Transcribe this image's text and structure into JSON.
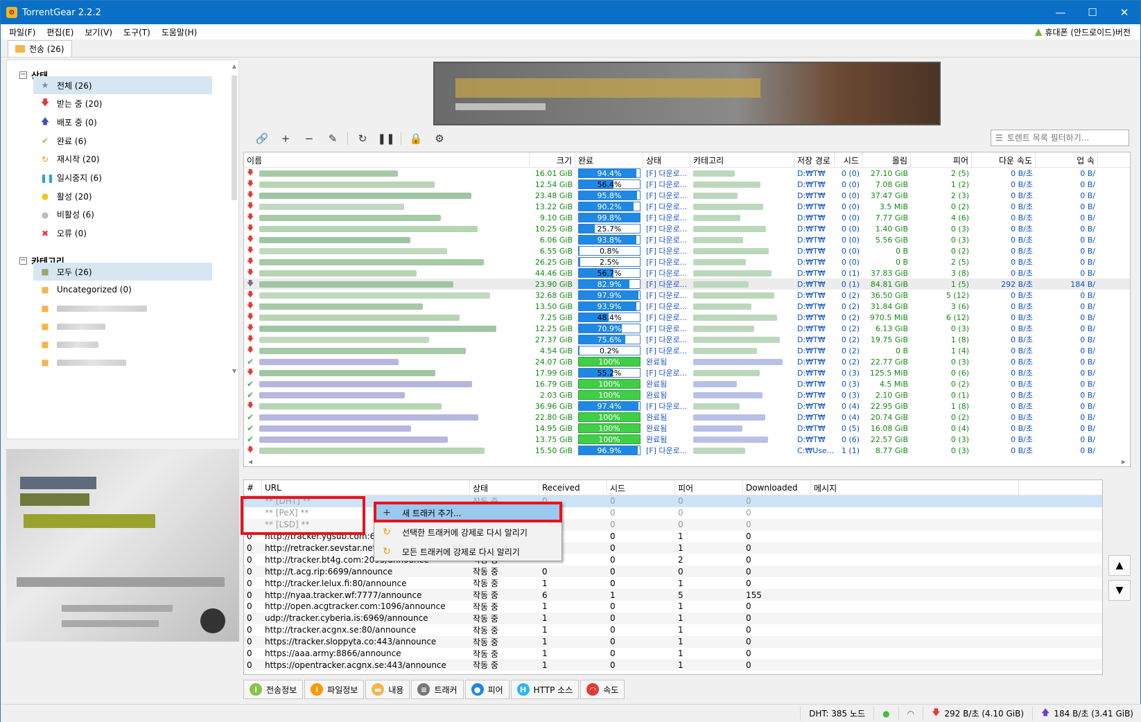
{
  "window": {
    "title": "TorrentGear 2.2.2",
    "min": "—",
    "max": "☐",
    "close": "✕"
  },
  "menu": [
    "파일(F)",
    "편집(E)",
    "보기(V)",
    "도구(T)",
    "도움말(H)"
  ],
  "android_label": "휴대폰 (안드로이드)버전",
  "tab": {
    "label": "전송 (26)"
  },
  "sidebar": {
    "status_title": "상태",
    "status_items": [
      {
        "icon": "★",
        "color": "#7a8aa8",
        "label": "전체 (26)",
        "name": "star-icon"
      },
      {
        "icon": "🡇",
        "color": "#e53935",
        "label": "받는 중 (20)",
        "name": "download-arrow-icon"
      },
      {
        "icon": "🡅",
        "color": "#3f51b5",
        "label": "배포 중 (0)",
        "name": "upload-arrow-icon"
      },
      {
        "icon": "✔",
        "color": "#8bc34a",
        "label": "완료 (6)",
        "name": "check-icon"
      },
      {
        "icon": "↻",
        "color": "#ff9800",
        "label": "재시작 (20)",
        "name": "restart-icon"
      },
      {
        "icon": "❚❚",
        "color": "#29a3d1",
        "label": "일시중지 (6)",
        "name": "pause-icon"
      },
      {
        "icon": "●",
        "color": "#f5c518",
        "label": "활성 (20)",
        "name": "bulb-on-icon"
      },
      {
        "icon": "●",
        "color": "#bdbdbd",
        "label": "비활성 (6)",
        "name": "bulb-off-icon"
      },
      {
        "icon": "✖",
        "color": "#e53935",
        "label": "오류 (0)",
        "name": "error-icon"
      }
    ],
    "category_title": "카테고리",
    "category_items": [
      {
        "label": "모두 (26)"
      },
      {
        "label": "Uncategorized (0)"
      }
    ]
  },
  "filter": {
    "placeholder": "토렌트 목록 필터하기..."
  },
  "toolbar": [
    {
      "name": "add-link-icon",
      "glyph": "🔗"
    },
    {
      "name": "add-icon",
      "glyph": "+"
    },
    {
      "name": "remove-icon",
      "glyph": "−"
    },
    {
      "name": "magic-wand-icon",
      "glyph": "✎"
    },
    {
      "name": "refresh-icon",
      "glyph": "↻"
    },
    {
      "name": "pause-icon",
      "glyph": "❚❚"
    },
    {
      "name": "lock-icon",
      "glyph": "🔒"
    },
    {
      "name": "settings-icon",
      "glyph": "⚙"
    }
  ],
  "torrent_headers": [
    "이름",
    "크기",
    "완료",
    "상태",
    "카테고리",
    "저장 경로",
    "시드",
    "올림",
    "피어",
    "다운 속도",
    "업 속"
  ],
  "torrents": [
    {
      "s": "dn",
      "size": "16.01 GiB",
      "pct": 94.4,
      "pt": "94.4%",
      "state": "[F] 다운로...",
      "path": "D:₩T₩",
      "seed": "0 (0)",
      "up": "27.10 GiB",
      "peer": "2 (5)",
      "dl": "0 B/초",
      "ul": "0 B/"
    },
    {
      "s": "dn",
      "size": "12.54 GiB",
      "pct": 56.4,
      "pt": "56.4%",
      "state": "[F] 다운로...",
      "path": "D:₩T₩",
      "seed": "0 (0)",
      "up": "7.08 GiB",
      "peer": "1 (2)",
      "dl": "0 B/초",
      "ul": "0 B/"
    },
    {
      "s": "dn",
      "size": "23.48 GiB",
      "pct": 95.8,
      "pt": "95.8%",
      "state": "[F] 다운로...",
      "path": "D:₩T₩",
      "seed": "0 (0)",
      "up": "37.47 GiB",
      "peer": "2 (3)",
      "dl": "0 B/초",
      "ul": "0 B/"
    },
    {
      "s": "dn",
      "size": "13.22 GiB",
      "pct": 90.2,
      "pt": "90.2%",
      "state": "[F] 다운로...",
      "path": "D:₩T₩",
      "seed": "0 (0)",
      "up": "3.5 MiB",
      "peer": "0 (2)",
      "dl": "0 B/초",
      "ul": "0 B/"
    },
    {
      "s": "dn",
      "size": "9.10 GiB",
      "pct": 99.8,
      "pt": "99.8%",
      "state": "[F] 다운로...",
      "path": "D:₩T₩",
      "seed": "0 (0)",
      "up": "7.77 GiB",
      "peer": "4 (6)",
      "dl": "0 B/초",
      "ul": "0 B/"
    },
    {
      "s": "dn",
      "size": "10.25 GiB",
      "pct": 25.7,
      "pt": "25.7%",
      "state": "[F] 다운로...",
      "path": "D:₩T₩",
      "seed": "0 (0)",
      "up": "1.40 GiB",
      "peer": "0 (3)",
      "dl": "0 B/초",
      "ul": "0 B/"
    },
    {
      "s": "dn",
      "size": "6.06 GiB",
      "pct": 93.8,
      "pt": "93.8%",
      "state": "[F] 다운로...",
      "path": "D:₩T₩",
      "seed": "0 (0)",
      "up": "5.56 GiB",
      "peer": "0 (3)",
      "dl": "0 B/초",
      "ul": "0 B/"
    },
    {
      "s": "dn",
      "size": "6.55 GiB",
      "pct": 0.8,
      "pt": "0.8%",
      "state": "[F] 다운로...",
      "path": "D:₩T₩",
      "seed": "0 (0)",
      "up": "0 B",
      "peer": "0 (2)",
      "dl": "0 B/초",
      "ul": "0 B/"
    },
    {
      "s": "dn",
      "size": "26.25 GiB",
      "pct": 2.5,
      "pt": "2.5%",
      "state": "[F] 다운로...",
      "path": "D:₩T₩",
      "seed": "0 (0)",
      "up": "0 B",
      "peer": "2 (5)",
      "dl": "0 B/초",
      "ul": "0 B/"
    },
    {
      "s": "dn",
      "size": "44.46 GiB",
      "pct": 56.7,
      "pt": "56.7%",
      "state": "[F] 다운로...",
      "path": "D:₩T₩",
      "seed": "0 (1)",
      "up": "37.83 GiB",
      "peer": "3 (8)",
      "dl": "0 B/초",
      "ul": "0 B/"
    },
    {
      "s": "dn2",
      "size": "23.90 GiB",
      "pct": 82.9,
      "pt": "82.9%",
      "state": "[F] 다운로...",
      "path": "D:₩T₩",
      "seed": "0 (1)",
      "up": "84.81 GiB",
      "peer": "1 (5)",
      "dl": "292 B/초",
      "ul": "184 B/"
    },
    {
      "s": "dn",
      "size": "32.68 GiB",
      "pct": 97.9,
      "pt": "97.9%",
      "state": "[F] 다운로...",
      "path": "D:₩T₩",
      "seed": "0 (2)",
      "up": "36.50 GiB",
      "peer": "5 (12)",
      "dl": "0 B/초",
      "ul": "0 B/"
    },
    {
      "s": "dn",
      "size": "13.50 GiB",
      "pct": 93.9,
      "pt": "93.9%",
      "state": "[F] 다운로...",
      "path": "D:₩T₩",
      "seed": "0 (2)",
      "up": "31.84 GiB",
      "peer": "3 (6)",
      "dl": "0 B/초",
      "ul": "0 B/"
    },
    {
      "s": "dn",
      "size": "7.25 GiB",
      "pct": 48.4,
      "pt": "48.4%",
      "state": "[F] 다운로...",
      "path": "D:₩T₩",
      "seed": "0 (2)",
      "up": "970.5 MiB",
      "peer": "6 (12)",
      "dl": "0 B/초",
      "ul": "0 B/"
    },
    {
      "s": "dn",
      "size": "12.25 GiB",
      "pct": 70.9,
      "pt": "70.9%",
      "state": "[F] 다운로...",
      "path": "D:₩T₩",
      "seed": "0 (2)",
      "up": "6.13 GiB",
      "peer": "0 (3)",
      "dl": "0 B/초",
      "ul": "0 B/"
    },
    {
      "s": "dn",
      "size": "27.37 GiB",
      "pct": 75.6,
      "pt": "75.6%",
      "state": "[F] 다운로...",
      "path": "D:₩T₩",
      "seed": "0 (2)",
      "up": "19.75 GiB",
      "peer": "1 (8)",
      "dl": "0 B/초",
      "ul": "0 B/"
    },
    {
      "s": "dn",
      "size": "4.54 GiB",
      "pct": 0.2,
      "pt": "0.2%",
      "state": "[F] 다운로...",
      "path": "D:₩T₩",
      "seed": "0 (2)",
      "up": "0 B",
      "peer": "1 (4)",
      "dl": "0 B/초",
      "ul": "0 B/"
    },
    {
      "s": "ok",
      "size": "24.07 GiB",
      "pct": 100,
      "pt": "100%",
      "state": "완료됨",
      "path": "D:₩T₩",
      "seed": "0 (2)",
      "up": "22.77 GiB",
      "peer": "0 (3)",
      "dl": "0 B/초",
      "ul": "0 B/"
    },
    {
      "s": "dn",
      "size": "17.99 GiB",
      "pct": 55.2,
      "pt": "55.2%",
      "state": "[F] 다운로...",
      "path": "D:₩T₩",
      "seed": "0 (3)",
      "up": "125.5 MiB",
      "peer": "0 (6)",
      "dl": "0 B/초",
      "ul": "0 B/"
    },
    {
      "s": "ok",
      "size": "16.79 GiB",
      "pct": 100,
      "pt": "100%",
      "state": "완료됨",
      "path": "D:₩T₩",
      "seed": "0 (3)",
      "up": "4.5 MiB",
      "peer": "0 (2)",
      "dl": "0 B/초",
      "ul": "0 B/"
    },
    {
      "s": "ok",
      "size": "2.03 GiB",
      "pct": 100,
      "pt": "100%",
      "state": "완료됨",
      "path": "D:₩T₩",
      "seed": "0 (3)",
      "up": "2.10 GiB",
      "peer": "0 (1)",
      "dl": "0 B/초",
      "ul": "0 B/"
    },
    {
      "s": "dn",
      "size": "36.96 GiB",
      "pct": 97.4,
      "pt": "97.4%",
      "state": "[F] 다운로...",
      "path": "D:₩T₩",
      "seed": "0 (4)",
      "up": "22.95 GiB",
      "peer": "1 (8)",
      "dl": "0 B/초",
      "ul": "0 B/"
    },
    {
      "s": "ok",
      "size": "22.80 GiB",
      "pct": 100,
      "pt": "100%",
      "state": "완료됨",
      "path": "D:₩T₩",
      "seed": "0 (4)",
      "up": "20.74 GiB",
      "peer": "0 (2)",
      "dl": "0 B/초",
      "ul": "0 B/"
    },
    {
      "s": "ok",
      "size": "14.95 GiB",
      "pct": 100,
      "pt": "100%",
      "state": "완료됨",
      "path": "D:₩T₩",
      "seed": "0 (5)",
      "up": "16.08 GiB",
      "peer": "0 (4)",
      "dl": "0 B/초",
      "ul": "0 B/"
    },
    {
      "s": "ok",
      "size": "13.75 GiB",
      "pct": 100,
      "pt": "100%",
      "state": "완료됨",
      "path": "D:₩T₩",
      "seed": "0 (6)",
      "up": "22.57 GiB",
      "peer": "0 (3)",
      "dl": "0 B/초",
      "ul": "0 B/"
    },
    {
      "s": "dn",
      "size": "15.50 GiB",
      "pct": 96.9,
      "pt": "96.9%",
      "state": "[F] 다운로...",
      "path": "C:₩Use...",
      "seed": "1 (1)",
      "up": "8.77 GiB",
      "peer": "0 (3)",
      "dl": "0 B/초",
      "ul": "0 B/"
    }
  ],
  "tracker_headers": [
    "#",
    "URL",
    "상태",
    "Received",
    "시드",
    "피어",
    "Downloaded",
    "메시지"
  ],
  "trackers": [
    {
      "n": "",
      "url": "** [DHT] **",
      "st": "작동 중",
      "rc": "0",
      "sd": "0",
      "pr": "0",
      "dl": "0",
      "cls": "sel gray"
    },
    {
      "n": "",
      "url": "** [PeX] **",
      "st": "작동 중",
      "rc": "0",
      "sd": "0",
      "pr": "0",
      "dl": "0",
      "cls": "gray"
    },
    {
      "n": "",
      "url": "** [LSD] **",
      "st": "작동 중",
      "rc": "0",
      "sd": "0",
      "pr": "0",
      "dl": "0",
      "cls": "gray"
    },
    {
      "n": "0",
      "url": "http://tracker.ygsub.com:6969/announce",
      "st": "작동 중",
      "rc": "0",
      "sd": "0",
      "pr": "1",
      "dl": "0",
      "cls": ""
    },
    {
      "n": "0",
      "url": "http://retracker.sevstar.net:2710/announce",
      "st": "작동 중",
      "rc": "0",
      "sd": "0",
      "pr": "1",
      "dl": "0",
      "cls": ""
    },
    {
      "n": "0",
      "url": "http://tracker.bt4g.com:2095/announce",
      "st": "작동 중",
      "rc": "",
      "sd": "0",
      "pr": "2",
      "dl": "0",
      "cls": ""
    },
    {
      "n": "0",
      "url": "http://t.acg.rip:6699/announce",
      "st": "작동 중",
      "rc": "0",
      "sd": "0",
      "pr": "0",
      "dl": "0",
      "cls": ""
    },
    {
      "n": "0",
      "url": "http://tracker.lelux.fi:80/announce",
      "st": "작동 중",
      "rc": "1",
      "sd": "0",
      "pr": "1",
      "dl": "0",
      "cls": ""
    },
    {
      "n": "0",
      "url": "http://nyaa.tracker.wf:7777/announce",
      "st": "작동 중",
      "rc": "6",
      "sd": "1",
      "pr": "5",
      "dl": "155",
      "cls": ""
    },
    {
      "n": "0",
      "url": "http://open.acgtracker.com:1096/announce",
      "st": "작동 중",
      "rc": "1",
      "sd": "0",
      "pr": "1",
      "dl": "0",
      "cls": ""
    },
    {
      "n": "0",
      "url": "udp://tracker.cyberia.is:6969/announce",
      "st": "작동 중",
      "rc": "1",
      "sd": "0",
      "pr": "1",
      "dl": "0",
      "cls": ""
    },
    {
      "n": "0",
      "url": "http://tracker.acgnx.se:80/announce",
      "st": "작동 중",
      "rc": "1",
      "sd": "0",
      "pr": "1",
      "dl": "0",
      "cls": ""
    },
    {
      "n": "0",
      "url": "https://tracker.sloppyta.co:443/announce",
      "st": "작동 중",
      "rc": "1",
      "sd": "0",
      "pr": "1",
      "dl": "0",
      "cls": ""
    },
    {
      "n": "0",
      "url": "https://aaa.army:8866/announce",
      "st": "작동 중",
      "rc": "1",
      "sd": "0",
      "pr": "1",
      "dl": "0",
      "cls": ""
    },
    {
      "n": "0",
      "url": "https://opentracker.acgnx.se:443/announce",
      "st": "작동 중",
      "rc": "1",
      "sd": "0",
      "pr": "1",
      "dl": "0",
      "cls": ""
    }
  ],
  "context_menu": [
    {
      "glyph": "+",
      "color": "#333",
      "label": "새 트래커 추가...",
      "name": "add-tracker-icon"
    },
    {
      "glyph": "↻",
      "color": "#ff9800",
      "label": "선택한 트래커에 강제로 다시 알리기",
      "name": "reannounce-icon"
    },
    {
      "glyph": "↻",
      "color": "#ff9800",
      "label": "모든 트래커에 강제로 다시 알리기",
      "name": "reannounce-all-icon"
    }
  ],
  "bottom_tabs": [
    {
      "label": "전송정보",
      "bg": "#8bc34a",
      "glyph": "i",
      "name": "info-icon"
    },
    {
      "label": "파일정보",
      "bg": "#ff9800",
      "glyph": "i",
      "name": "file-info-icon"
    },
    {
      "label": "내용",
      "bg": "#f3b64b",
      "glyph": "▬",
      "name": "folder-icon"
    },
    {
      "label": "트래커",
      "bg": "#757575",
      "glyph": "≡",
      "name": "tracker-icon"
    },
    {
      "label": "피어",
      "bg": "#1e88e5",
      "glyph": "●",
      "name": "peers-icon"
    },
    {
      "label": "HTTP 소스",
      "bg": "#29b6f6",
      "glyph": "H",
      "name": "http-icon"
    },
    {
      "label": "속도",
      "bg": "#e53935",
      "glyph": "◠",
      "name": "speed-icon"
    }
  ],
  "status": {
    "dht": "DHT: 385 노드",
    "down": "292 B/초 (4.10 GiB)",
    "up": "184 B/초 (3.41 GiB)"
  }
}
